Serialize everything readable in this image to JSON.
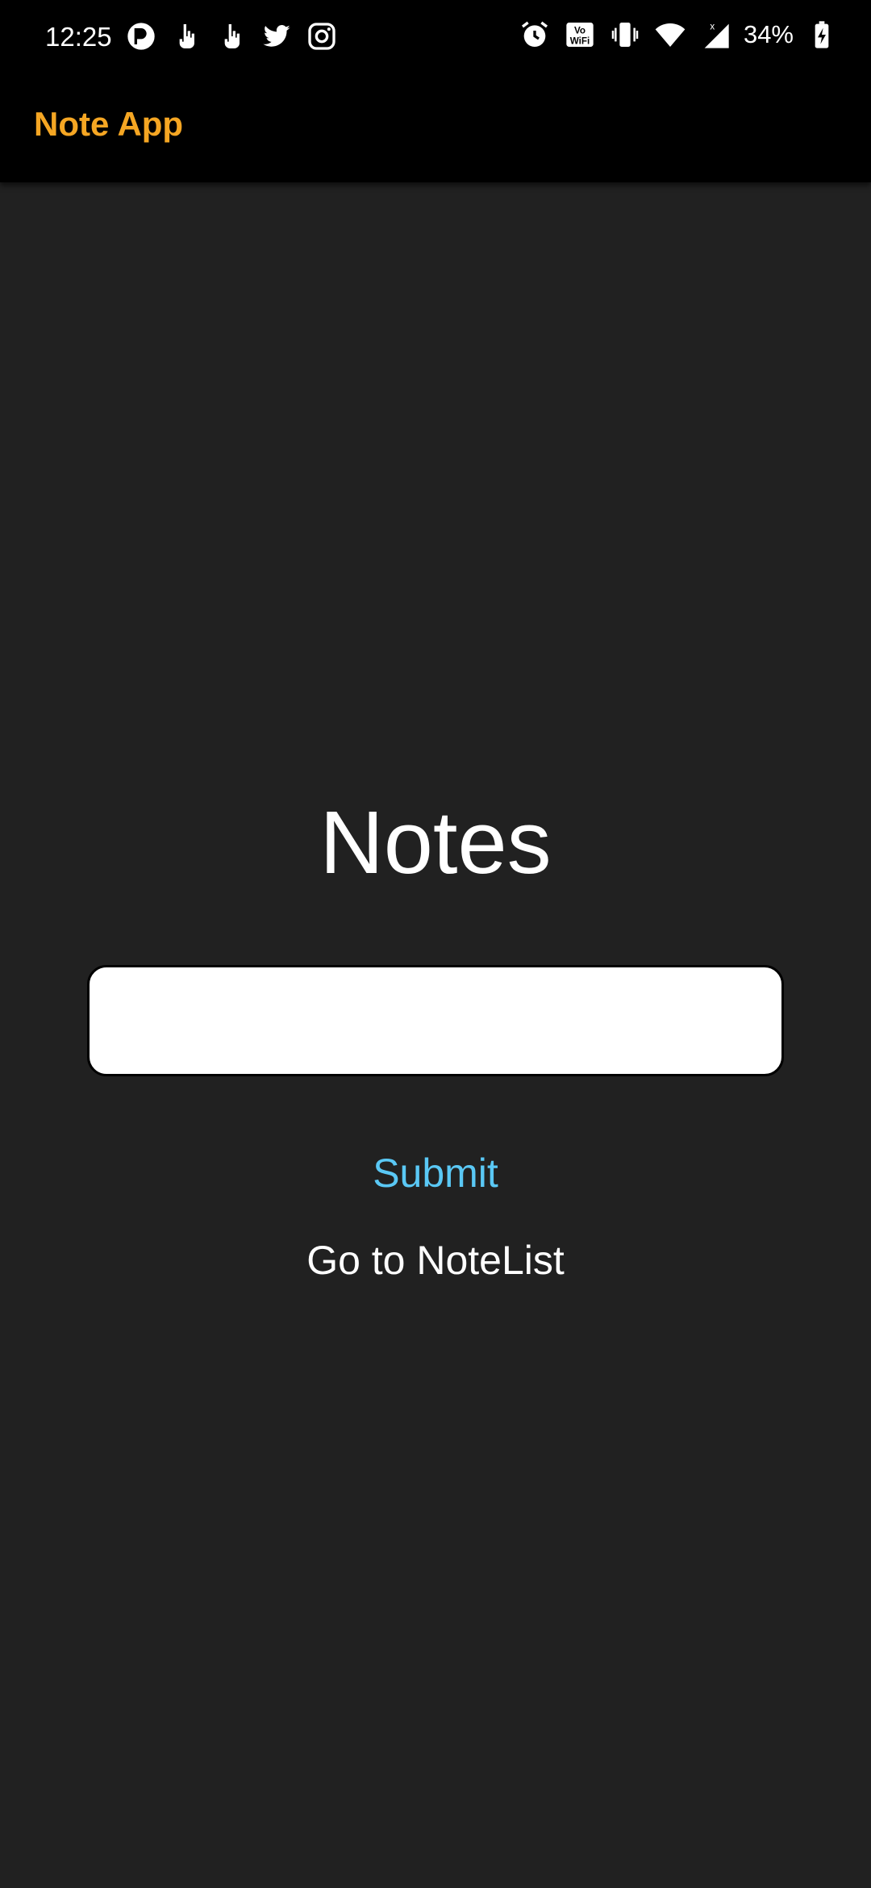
{
  "status_bar": {
    "time": "12:25",
    "left_icons": [
      "pinwheel-app-icon",
      "touch-hand-icon",
      "touch-hand-icon",
      "twitter-icon",
      "instagram-icon"
    ],
    "right_icons": [
      "alarm-icon",
      "vowifi-icon",
      "vibrate-icon",
      "wifi-icon",
      "cell-signal-icon"
    ],
    "battery_percent": "34%"
  },
  "app_bar": {
    "title": "Note App",
    "title_color": "#f5a623"
  },
  "main": {
    "heading": "Notes",
    "note_input": {
      "value": "",
      "placeholder": ""
    },
    "submit_label": "Submit",
    "submit_color": "#5ac8f5",
    "notelist_label": "Go to NoteList"
  },
  "colors": {
    "background": "#212121",
    "bar_background": "#000000"
  }
}
